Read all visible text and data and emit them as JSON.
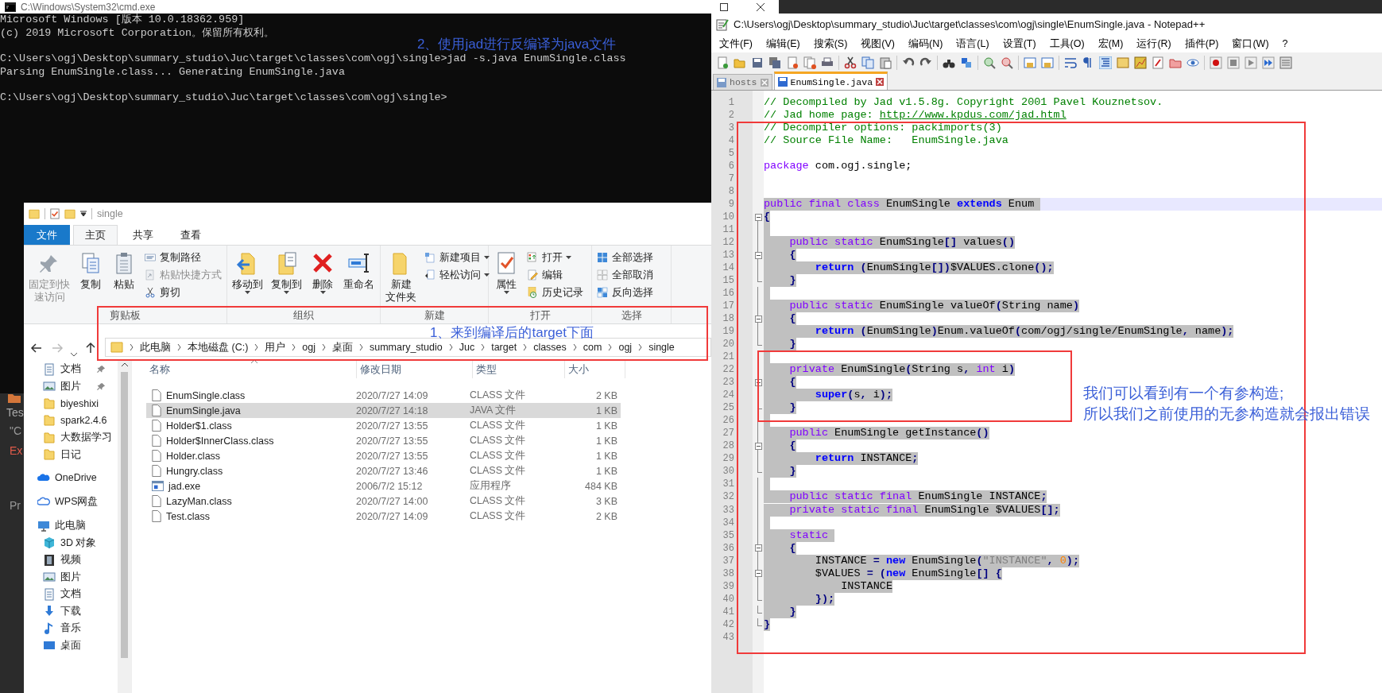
{
  "cmd_window": {
    "title": "C:\\Windows\\System32\\cmd.exe",
    "blocks": [
      [
        "Microsoft Windows [版本 10.0.18362.959]",
        "(c) 2019 Microsoft Corporation。保留所有权利。"
      ],
      [
        "C:\\Users\\ogj\\Desktop\\summary_studio\\Juc\\target\\classes\\com\\ogj\\single>jad -s.java EnumSingle.class",
        "Parsing EnumSingle.class... Generating EnumSingle.java"
      ],
      [
        "C:\\Users\\ogj\\Desktop\\summary_studio\\Juc\\target\\classes\\com\\ogj\\single>"
      ]
    ],
    "annotation": "2、使用jad进行反编译为java文件"
  },
  "ide_fragments": [
    {
      "text": "Tes",
      "kind": "tab"
    },
    {
      "text": "\"C",
      "kind": "plain"
    },
    {
      "text": "Ex",
      "kind": "error"
    },
    {
      "text": "Pr",
      "kind": "plain"
    }
  ],
  "explorer": {
    "title": "single",
    "file_tab": "文件",
    "tabs": [
      {
        "label": "主页",
        "selected": true
      },
      {
        "label": "共享",
        "selected": false
      },
      {
        "label": "查看",
        "selected": false
      }
    ],
    "ribbon": [
      {
        "label": "剪贴板",
        "items": [
          {
            "kind": "large",
            "lines": [
              "固定到快",
              "速访问"
            ],
            "disabled": true,
            "dropdown": false
          },
          {
            "kind": "large",
            "lines": [
              "复制"
            ],
            "disabled": false,
            "dropdown": false
          },
          {
            "kind": "large",
            "lines": [
              "粘贴"
            ],
            "disabled": false,
            "dropdown": false
          },
          {
            "kind": "small",
            "lines": [
              "复制路径"
            ],
            "disabled": false,
            "dropdown": false
          },
          {
            "kind": "small",
            "lines": [
              "粘贴快捷方式"
            ],
            "disabled": true,
            "dropdown": false
          },
          {
            "kind": "small",
            "lines": [
              "剪切"
            ],
            "disabled": false,
            "dropdown": false
          }
        ]
      },
      {
        "label": "组织",
        "items": [
          {
            "kind": "large",
            "lines": [
              "移动到"
            ],
            "disabled": false,
            "dropdown": true
          },
          {
            "kind": "large",
            "lines": [
              "复制到"
            ],
            "disabled": false,
            "dropdown": true
          },
          {
            "kind": "large",
            "lines": [
              "删除"
            ],
            "disabled": false,
            "dropdown": true
          },
          {
            "kind": "large",
            "lines": [
              "重命名"
            ],
            "disabled": false,
            "dropdown": false
          }
        ]
      },
      {
        "label": "新建",
        "items": [
          {
            "kind": "large",
            "lines": [
              "新建",
              "文件夹"
            ],
            "disabled": false,
            "dropdown": false
          },
          {
            "kind": "small",
            "lines": [
              "新建项目"
            ],
            "disabled": false,
            "dropdown": true
          },
          {
            "kind": "small",
            "lines": [
              "轻松访问"
            ],
            "disabled": false,
            "dropdown": true
          }
        ]
      },
      {
        "label": "打开",
        "items": [
          {
            "kind": "large",
            "lines": [
              "属性"
            ],
            "disabled": false,
            "dropdown": true
          },
          {
            "kind": "small",
            "lines": [
              "打开"
            ],
            "disabled": false,
            "dropdown": true
          },
          {
            "kind": "small",
            "lines": [
              "编辑"
            ],
            "disabled": false,
            "dropdown": false
          },
          {
            "kind": "small",
            "lines": [
              "历史记录"
            ],
            "disabled": false,
            "dropdown": false
          }
        ]
      },
      {
        "label": "选择",
        "items": [
          {
            "kind": "small",
            "lines": [
              "全部选择"
            ],
            "disabled": false,
            "dropdown": false
          },
          {
            "kind": "small",
            "lines": [
              "全部取消"
            ],
            "disabled": false,
            "dropdown": false
          },
          {
            "kind": "small",
            "lines": [
              "反向选择"
            ],
            "disabled": false,
            "dropdown": false
          }
        ]
      }
    ],
    "breadcrumb": [
      "此电脑",
      "本地磁盘 (C:)",
      "用户",
      "ogj",
      "桌面",
      "summary_studio",
      "Juc",
      "target",
      "classes",
      "com",
      "ogj",
      "single"
    ],
    "annotation": "1、来到编译后的target下面",
    "quick_access": [
      {
        "label": "文档",
        "kind": "doc",
        "pinned": true
      },
      {
        "label": "图片",
        "kind": "pic",
        "pinned": true
      },
      {
        "label": "biyeshixi",
        "kind": "folder",
        "pinned": false
      },
      {
        "label": "spark2.4.6",
        "kind": "folder",
        "pinned": false
      },
      {
        "label": "大数据学习",
        "kind": "folder",
        "pinned": false
      },
      {
        "label": "日记",
        "kind": "folder",
        "pinned": false
      }
    ],
    "nav_roots": [
      {
        "label": "OneDrive",
        "kind": "onedrive"
      },
      {
        "label": "WPS网盘",
        "kind": "cloud"
      },
      {
        "label": "此电脑",
        "kind": "pc",
        "children": [
          {
            "label": "3D 对象",
            "kind": "cube"
          },
          {
            "label": "视频",
            "kind": "video"
          },
          {
            "label": "图片",
            "kind": "pic"
          },
          {
            "label": "文档",
            "kind": "doc"
          },
          {
            "label": "下载",
            "kind": "download"
          },
          {
            "label": "音乐",
            "kind": "music"
          },
          {
            "label": "桌面",
            "kind": "desktop"
          }
        ]
      }
    ],
    "columns": [
      "名称",
      "修改日期",
      "类型",
      "大小"
    ],
    "files": [
      {
        "name": "EnumSingle.class",
        "date": "2020/7/27 14:09",
        "type": "CLASS 文件",
        "size": "2 KB",
        "kind": "file",
        "selected": false
      },
      {
        "name": "EnumSingle.java",
        "date": "2020/7/27 14:18",
        "type": "JAVA 文件",
        "size": "1 KB",
        "kind": "file",
        "selected": true
      },
      {
        "name": "Holder$1.class",
        "date": "2020/7/27 13:55",
        "type": "CLASS 文件",
        "size": "1 KB",
        "kind": "file",
        "selected": false
      },
      {
        "name": "Holder$InnerClass.class",
        "date": "2020/7/27 13:55",
        "type": "CLASS 文件",
        "size": "1 KB",
        "kind": "file",
        "selected": false
      },
      {
        "name": "Holder.class",
        "date": "2020/7/27 13:55",
        "type": "CLASS 文件",
        "size": "1 KB",
        "kind": "file",
        "selected": false
      },
      {
        "name": "Hungry.class",
        "date": "2020/7/27 13:46",
        "type": "CLASS 文件",
        "size": "1 KB",
        "kind": "file",
        "selected": false
      },
      {
        "name": "jad.exe",
        "date": "2006/7/2 15:12",
        "type": "应用程序",
        "size": "484 KB",
        "kind": "exe",
        "selected": false
      },
      {
        "name": "LazyMan.class",
        "date": "2020/7/27 14:00",
        "type": "CLASS 文件",
        "size": "3 KB",
        "kind": "file",
        "selected": false
      },
      {
        "name": "Test.class",
        "date": "2020/7/27 14:09",
        "type": "CLASS 文件",
        "size": "2 KB",
        "kind": "file",
        "selected": false
      }
    ]
  },
  "notepad": {
    "title": "C:\\Users\\ogj\\Desktop\\summary_studio\\Juc\\target\\classes\\com\\ogj\\single\\EnumSingle.java - Notepad++",
    "menu": [
      "文件(F)",
      "编辑(E)",
      "搜索(S)",
      "视图(V)",
      "编码(N)",
      "语言(L)",
      "设置(T)",
      "工具(O)",
      "宏(M)",
      "运行(R)",
      "插件(P)",
      "窗口(W)",
      "?"
    ],
    "tabs": [
      {
        "label": "hosts",
        "selected": false
      },
      {
        "label": "EnumSingle.java",
        "selected": true
      }
    ],
    "lines": [
      {
        "n": "1",
        "selected": false,
        "tokens": [
          {
            "text": "// Decompiled by Jad v1.5.8g. Copyright 2001 Pavel Kouznetsov.",
            "kind": "comment"
          }
        ]
      },
      {
        "n": "2",
        "selected": false,
        "tokens": [
          {
            "text": "// Jad home page: ",
            "kind": "comment"
          },
          {
            "text": "http://www.kpdus.com/jad.html",
            "kind": "link"
          }
        ]
      },
      {
        "n": "3",
        "selected": false,
        "tokens": [
          {
            "text": "// Decompiler options: packimports(3)",
            "kind": "comment"
          }
        ]
      },
      {
        "n": "4",
        "selected": false,
        "tokens": [
          {
            "text": "// Source File Name:   EnumSingle.java",
            "kind": "comment"
          }
        ]
      },
      {
        "n": "5",
        "selected": false
      },
      {
        "n": "6",
        "selected": false,
        "tokens": [
          {
            "text": "package",
            "kind": "keyword"
          },
          {
            "text": " com.ogj.single;",
            "kind": "plain"
          }
        ]
      },
      {
        "n": "7",
        "selected": false
      },
      {
        "n": "8",
        "selected": false
      },
      {
        "n": "9",
        "selected": true,
        "current": true,
        "tokens": [
          {
            "text": "public final class",
            "kind": "keyword"
          },
          {
            "text": " EnumSingle ",
            "kind": "plain"
          },
          {
            "text": "extends",
            "kind": "statement"
          },
          {
            "text": " Enum ",
            "kind": "plain"
          }
        ]
      },
      {
        "n": "10",
        "selected": true,
        "fold_start": true,
        "tokens": [
          {
            "text": "{",
            "kind": "operator"
          }
        ]
      },
      {
        "n": "11",
        "selected": true,
        "fold_guide": true
      },
      {
        "n": "12",
        "selected": true,
        "fold_guide": true,
        "tokens": [
          {
            "text": "    public static",
            "kind": "keyword"
          },
          {
            "text": " EnumSingle",
            "kind": "plain"
          },
          {
            "text": "[]",
            "kind": "operator"
          },
          {
            "text": " values",
            "kind": "plain"
          },
          {
            "text": "()",
            "kind": "operator"
          }
        ]
      },
      {
        "n": "13",
        "selected": true,
        "fold_start": true,
        "tokens": [
          {
            "text": "    {",
            "kind": "operator"
          }
        ]
      },
      {
        "n": "14",
        "selected": true,
        "fold_guide": true,
        "tokens": [
          {
            "text": "        return",
            "kind": "statement"
          },
          {
            "text": " (",
            "kind": "operator"
          },
          {
            "text": "EnumSingle",
            "kind": "plain"
          },
          {
            "text": "[])",
            "kind": "operator"
          },
          {
            "text": "$VALUES.clone",
            "kind": "plain"
          },
          {
            "text": "();",
            "kind": "operator"
          }
        ]
      },
      {
        "n": "15",
        "selected": true,
        "fold_end": true,
        "tokens": [
          {
            "text": "    }",
            "kind": "operator"
          }
        ]
      },
      {
        "n": "16",
        "selected": true,
        "fold_guide": true
      },
      {
        "n": "17",
        "selected": true,
        "fold_guide": true,
        "tokens": [
          {
            "text": "    public static",
            "kind": "keyword"
          },
          {
            "text": " EnumSingle valueOf",
            "kind": "plain"
          },
          {
            "text": "(",
            "kind": "operator"
          },
          {
            "text": "String name",
            "kind": "plain"
          },
          {
            "text": ")",
            "kind": "operator"
          }
        ]
      },
      {
        "n": "18",
        "selected": true,
        "fold_start": true,
        "tokens": [
          {
            "text": "    {",
            "kind": "operator"
          }
        ]
      },
      {
        "n": "19",
        "selected": true,
        "fold_guide": true,
        "tokens": [
          {
            "text": "        return",
            "kind": "statement"
          },
          {
            "text": " (",
            "kind": "operator"
          },
          {
            "text": "EnumSingle",
            "kind": "plain"
          },
          {
            "text": ")",
            "kind": "operator"
          },
          {
            "text": "Enum.valueOf",
            "kind": "plain"
          },
          {
            "text": "(",
            "kind": "operator"
          },
          {
            "text": "com/ogj/single/EnumSingle",
            "kind": "plain"
          },
          {
            "text": ",",
            "kind": "operator"
          },
          {
            "text": " name",
            "kind": "plain"
          },
          {
            "text": ");",
            "kind": "operator"
          }
        ]
      },
      {
        "n": "20",
        "selected": true,
        "fold_end": true,
        "tokens": [
          {
            "text": "    }",
            "kind": "operator"
          }
        ]
      },
      {
        "n": "21",
        "selected": true,
        "fold_guide": true
      },
      {
        "n": "22",
        "selected": true,
        "fold_guide": true,
        "tokens": [
          {
            "text": "    private",
            "kind": "keyword"
          },
          {
            "text": " EnumSingle",
            "kind": "plain"
          },
          {
            "text": "(",
            "kind": "operator"
          },
          {
            "text": "String s",
            "kind": "plain"
          },
          {
            "text": ",",
            "kind": "operator"
          },
          {
            "text": " int",
            "kind": "keyword"
          },
          {
            "text": " i",
            "kind": "plain"
          },
          {
            "text": ")",
            "kind": "operator"
          }
        ]
      },
      {
        "n": "23",
        "selected": true,
        "fold_start": true,
        "tokens": [
          {
            "text": "    {",
            "kind": "operator"
          }
        ]
      },
      {
        "n": "24",
        "selected": true,
        "fold_guide": true,
        "tokens": [
          {
            "text": "        super",
            "kind": "statement"
          },
          {
            "text": "(",
            "kind": "operator"
          },
          {
            "text": "s",
            "kind": "plain"
          },
          {
            "text": ",",
            "kind": "operator"
          },
          {
            "text": " i",
            "kind": "plain"
          },
          {
            "text": ");",
            "kind": "operator"
          }
        ]
      },
      {
        "n": "25",
        "selected": true,
        "fold_end": true,
        "tokens": [
          {
            "text": "    }",
            "kind": "operator"
          }
        ]
      },
      {
        "n": "26",
        "selected": true,
        "fold_guide": true
      },
      {
        "n": "27",
        "selected": true,
        "fold_guide": true,
        "tokens": [
          {
            "text": "    public",
            "kind": "keyword"
          },
          {
            "text": " EnumSingle getInstance",
            "kind": "plain"
          },
          {
            "text": "()",
            "kind": "operator"
          }
        ]
      },
      {
        "n": "28",
        "selected": true,
        "fold_start": true,
        "tokens": [
          {
            "text": "    {",
            "kind": "operator"
          }
        ]
      },
      {
        "n": "29",
        "selected": true,
        "fold_guide": true,
        "tokens": [
          {
            "text": "        return",
            "kind": "statement"
          },
          {
            "text": " INSTANCE",
            "kind": "plain"
          },
          {
            "text": ";",
            "kind": "operator"
          }
        ]
      },
      {
        "n": "30",
        "selected": true,
        "fold_end": true,
        "tokens": [
          {
            "text": "    }",
            "kind": "operator"
          }
        ]
      },
      {
        "n": "31",
        "selected": true,
        "fold_guide": true
      },
      {
        "n": "32",
        "selected": true,
        "fold_guide": true,
        "tokens": [
          {
            "text": "    public static final",
            "kind": "keyword"
          },
          {
            "text": " EnumSingle INSTANCE",
            "kind": "plain"
          },
          {
            "text": ";",
            "kind": "operator"
          }
        ]
      },
      {
        "n": "33",
        "selected": true,
        "fold_guide": true,
        "tokens": [
          {
            "text": "    private static final",
            "kind": "keyword"
          },
          {
            "text": " EnumSingle $VALUES",
            "kind": "plain"
          },
          {
            "text": "[];",
            "kind": "operator"
          }
        ]
      },
      {
        "n": "34",
        "selected": true,
        "fold_guide": true
      },
      {
        "n": "35",
        "selected": true,
        "fold_guide": true,
        "tokens": [
          {
            "text": "    static ",
            "kind": "keyword"
          }
        ]
      },
      {
        "n": "36",
        "selected": true,
        "fold_start": true,
        "tokens": [
          {
            "text": "    {",
            "kind": "operator"
          }
        ]
      },
      {
        "n": "37",
        "selected": true,
        "fold_guide": true,
        "tokens": [
          {
            "text": "        INSTANCE ",
            "kind": "plain"
          },
          {
            "text": "=",
            "kind": "operator"
          },
          {
            "text": " new",
            "kind": "statement"
          },
          {
            "text": " EnumSingle",
            "kind": "plain"
          },
          {
            "text": "(",
            "kind": "operator"
          },
          {
            "text": "\"INSTANCE\"",
            "kind": "string"
          },
          {
            "text": ",",
            "kind": "operator"
          },
          {
            "text": " 0",
            "kind": "number"
          },
          {
            "text": ");",
            "kind": "operator"
          }
        ]
      },
      {
        "n": "38",
        "selected": true,
        "fold_start": true,
        "tokens": [
          {
            "text": "        $VALUES ",
            "kind": "plain"
          },
          {
            "text": "= (",
            "kind": "operator"
          },
          {
            "text": "new",
            "kind": "statement"
          },
          {
            "text": " EnumSingle",
            "kind": "plain"
          },
          {
            "text": "[] {",
            "kind": "operator"
          }
        ]
      },
      {
        "n": "39",
        "selected": true,
        "fold_guide": true,
        "tokens": [
          {
            "text": "            INSTANCE",
            "kind": "plain"
          }
        ]
      },
      {
        "n": "40",
        "selected": true,
        "fold_end": true,
        "tokens": [
          {
            "text": "        });",
            "kind": "operator"
          }
        ]
      },
      {
        "n": "41",
        "selected": true,
        "fold_end": true,
        "tokens": [
          {
            "text": "    }",
            "kind": "operator"
          }
        ]
      },
      {
        "n": "42",
        "selected": true,
        "fold_end": true,
        "tokens": [
          {
            "text": "}",
            "kind": "operator"
          }
        ]
      },
      {
        "n": "43",
        "selected": false
      }
    ],
    "annotation": [
      "我们可以看到有一个有参构造;",
      "所以我们之前使用的无参构造就会报出错误"
    ]
  }
}
